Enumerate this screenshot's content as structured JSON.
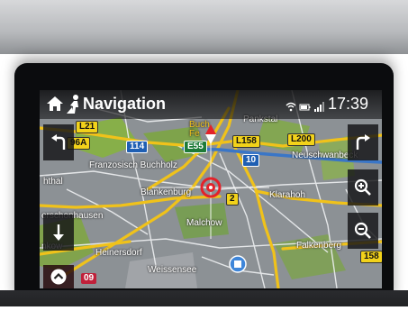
{
  "header": {
    "title": "Navigation",
    "time": "17:39"
  },
  "icons": {
    "home": "home-icon",
    "navigation": "navigation-person-icon",
    "wifi": "wifi-icon",
    "battery": "battery-icon",
    "signal": "signal-icon"
  },
  "side_buttons": {
    "left": [
      "turn-left-icon",
      "arrow-down-icon",
      "chevron-up-icon"
    ],
    "right": [
      "turn-right-icon",
      "zoom-in-icon",
      "zoom-out-icon"
    ]
  },
  "map": {
    "places": [
      "Franzosisch Buchholz",
      "Blankenburg",
      "Malchow",
      "Heinersdorf",
      "Weissensee",
      "Falkenberg",
      "Klarahoh",
      "Neuschwanbeck",
      "hthal",
      "erschonhausen",
      "nkow",
      "Buch",
      "Fe",
      "Pankstal"
    ],
    "shields": {
      "L21": "L21",
      "r96A": "96A",
      "r114": "114",
      "E55": "E55",
      "L158": "L158",
      "L200": "L200",
      "r10": "10",
      "r2": "2",
      "r158": "158",
      "r09": "09"
    }
  },
  "colors": {
    "map_base": "#8f9497",
    "road_yellow": "#f0c21a",
    "forest_green": "#7fae3a",
    "cursor_red": "#e3222a"
  }
}
